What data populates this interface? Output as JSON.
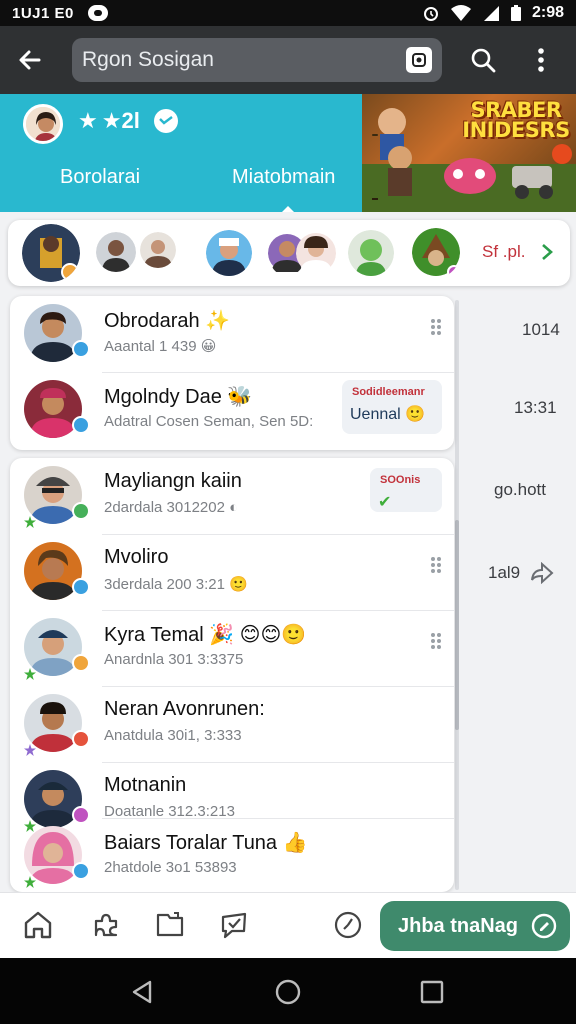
{
  "status_bar": {
    "left_time": "1UJ1 E0",
    "clock": "2:98"
  },
  "search": {
    "placeholder": "Rgon Sosigan"
  },
  "profile": {
    "rating": "★2l",
    "tabs": [
      "Borolarai",
      "Miatobmain"
    ]
  },
  "banner": {
    "title": "SRABER INIDESRS"
  },
  "stories": {
    "more_label": "Sf .pl."
  },
  "chats": [
    {
      "name": "Obrodarah ✨",
      "sub": "Aaantal 1 439 😀",
      "time": "1014",
      "status_color": "#3aa0e0"
    },
    {
      "name": "Mgolndy Dae 🐝",
      "sub": "Adatral Cosen Seman, Sen 5D:",
      "time": "13:31",
      "status_color": "#3aa0e0",
      "chip": {
        "top": "Sodidleemanr",
        "bottom": "Uennal 🙂"
      }
    },
    {
      "name": "Mayliangn kaiin",
      "sub": "2dardala 3012202 ◐",
      "time": "go.hott",
      "status_color": "#46b05a",
      "chip": {
        "top": "SOOnis",
        "bottom": "✔"
      }
    },
    {
      "name": "Mvoliro",
      "sub": "3derdala 200 3:21 🙂",
      "time": "1al9",
      "status_color": "#3aa0e0"
    },
    {
      "name": "Kyra Temal 🎉 😊😊🙂",
      "sub": "Anardnla 301 3:3375",
      "status_color": "#f0a53b"
    },
    {
      "name": "Neran Avonrunen:",
      "sub": "Anatdula 30i1, 3:333",
      "status_color": "#e5533c"
    },
    {
      "name": "Motnanin",
      "sub": "Doatanle 312.3:213",
      "status_color": "#c053c0"
    },
    {
      "name": "Baiars Toralar Tuna 👍",
      "sub": "2hatdole 3o1 53893",
      "status_color": "#3aa0e0"
    }
  ],
  "fab": {
    "label": "Jhba tnaNag"
  },
  "colors": {
    "accent": "#29b8cf",
    "fab": "#3f8a6c",
    "appbar": "#2f3133"
  }
}
